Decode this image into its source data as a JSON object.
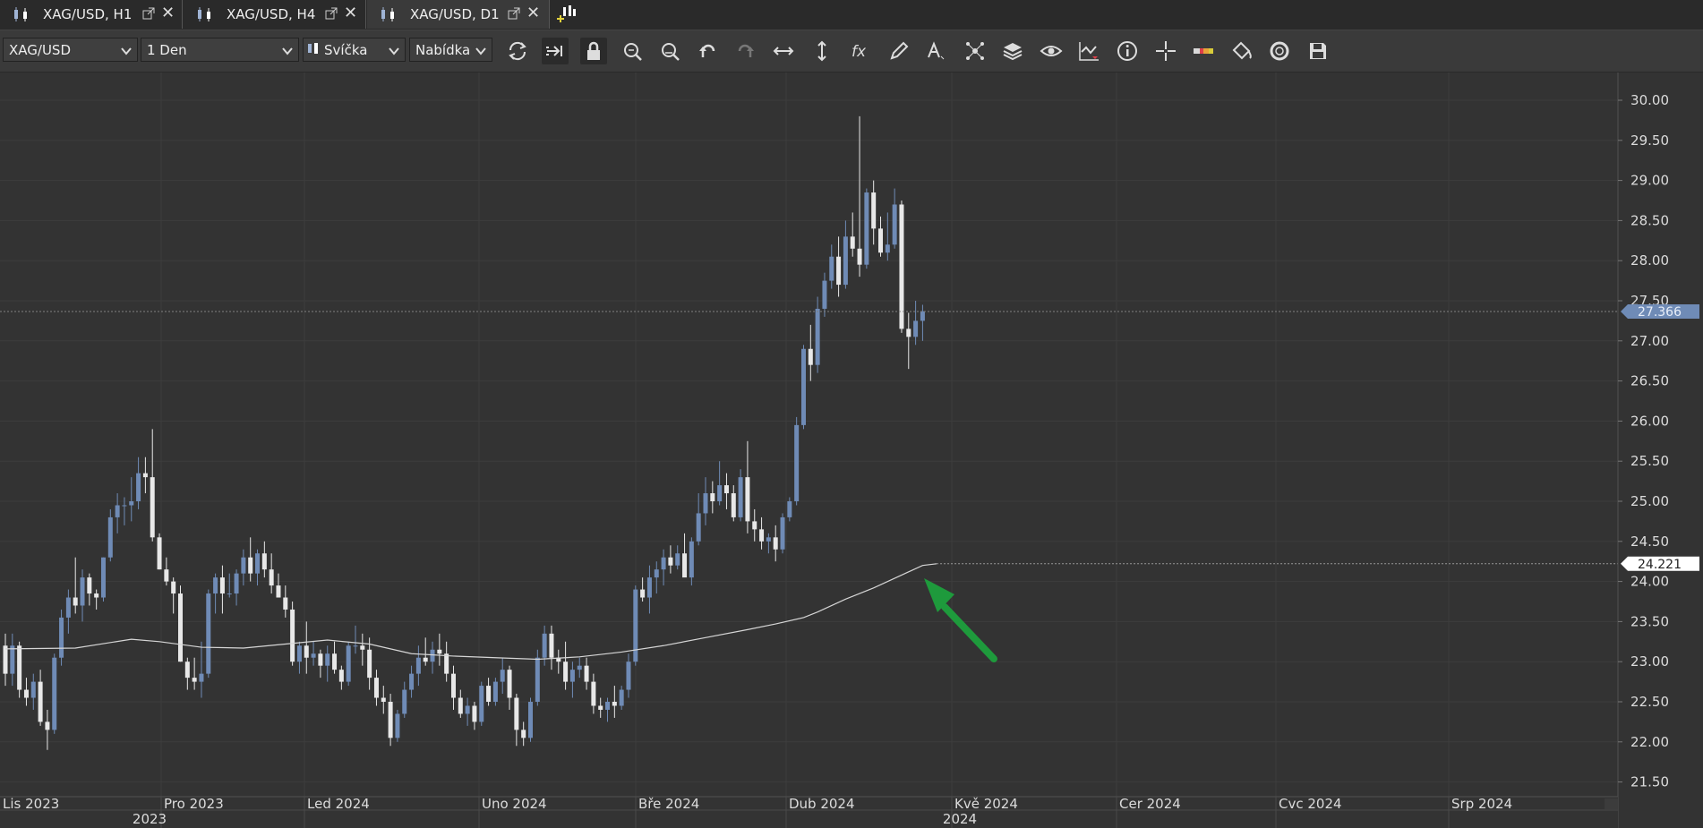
{
  "tabs": [
    {
      "label": "XAG/USD, H1",
      "active": false
    },
    {
      "label": "XAG/USD, H4",
      "active": false
    },
    {
      "label": "XAG/USD, D1",
      "active": true
    }
  ],
  "new_tab_icon": "add-chart-icon",
  "toolbar": {
    "instrument": "XAG/USD",
    "period": "1 Den",
    "chart_type": "Svíčka",
    "price_side": "Nabídka",
    "icons": [
      "refresh-icon",
      "auto-shift-icon",
      "lock-icon",
      "zoom-in-icon",
      "zoom-out-icon",
      "undo-icon",
      "redo-icon",
      "fit-horizontal-icon",
      "fit-vertical-icon",
      "function-icon",
      "pencil-icon",
      "text-icon",
      "network-icon",
      "layers-icon",
      "eye-icon",
      "signal-icon",
      "info-icon",
      "crosshair-icon",
      "level-indicator-icon",
      "paint-bucket-icon",
      "cycle-icon",
      "save-icon"
    ]
  },
  "colors": {
    "background": "#333333",
    "bull": "#6f8bb6",
    "bear": "#e8e8e8",
    "ma_line": "#d6d6d6",
    "arrow": "#1e9a3c",
    "grid": "#3d3d3d"
  },
  "chart_data": {
    "type": "candlestick",
    "title": "",
    "y_ticks": [
      "30.00",
      "29.50",
      "29.00",
      "28.50",
      "28.00",
      "27.50",
      "27.00",
      "26.50",
      "26.00",
      "25.50",
      "25.00",
      "24.50",
      "24.00",
      "23.50",
      "23.00",
      "22.50",
      "22.00",
      "21.50"
    ],
    "ylim": [
      21.4,
      30.3
    ],
    "x_month_labels": [
      "Lis 2023",
      "Pro 2023",
      "Led 2024",
      "Uno 2024",
      "Bře 2024",
      "Dub 2024",
      "Kvě 2024",
      "Cer 2024",
      "Cvc 2024",
      "Srp 2024"
    ],
    "x_year_labels": [
      "2023",
      "2024"
    ],
    "x_range_days": [
      0,
      230
    ],
    "current_price": "27.366",
    "ma_value": "24.221",
    "candles": [
      [
        0,
        23.2,
        23.35,
        22.7,
        22.85
      ],
      [
        1,
        22.85,
        23.35,
        22.7,
        23.2
      ],
      [
        2,
        23.2,
        23.25,
        22.55,
        22.65
      ],
      [
        3,
        22.65,
        22.8,
        22.45,
        22.55
      ],
      [
        4,
        22.55,
        22.85,
        22.4,
        22.75
      ],
      [
        5,
        22.75,
        22.9,
        22.2,
        22.25
      ],
      [
        6,
        22.25,
        22.4,
        21.9,
        22.15
      ],
      [
        7,
        22.15,
        23.1,
        22.1,
        23.05
      ],
      [
        8,
        23.05,
        23.65,
        22.95,
        23.55
      ],
      [
        9,
        23.55,
        23.9,
        23.35,
        23.8
      ],
      [
        10,
        23.8,
        24.3,
        23.6,
        23.7
      ],
      [
        11,
        23.7,
        24.15,
        23.5,
        24.05
      ],
      [
        12,
        24.05,
        24.1,
        23.7,
        23.85
      ],
      [
        13,
        23.85,
        23.9,
        23.65,
        23.8
      ],
      [
        14,
        23.8,
        24.3,
        23.75,
        24.3
      ],
      [
        15,
        24.3,
        24.9,
        24.25,
        24.8
      ],
      [
        16,
        24.8,
        25.1,
        24.6,
        24.95
      ],
      [
        17,
        24.95,
        25.05,
        24.7,
        24.95
      ],
      [
        18,
        24.95,
        25.3,
        24.75,
        25.0
      ],
      [
        19,
        25.0,
        25.55,
        24.9,
        25.35
      ],
      [
        20,
        25.35,
        25.55,
        25.1,
        25.3
      ],
      [
        21,
        25.3,
        25.9,
        24.5,
        24.55
      ],
      [
        22,
        24.55,
        24.6,
        24.15,
        24.15
      ],
      [
        23,
        24.15,
        24.3,
        23.95,
        24.0
      ],
      [
        24,
        24.0,
        24.05,
        23.6,
        23.85
      ],
      [
        25,
        23.85,
        23.95,
        23.0,
        23.0
      ],
      [
        26,
        23.0,
        23.05,
        22.65,
        22.8
      ],
      [
        27,
        22.8,
        23.05,
        22.65,
        22.75
      ],
      [
        28,
        22.75,
        23.25,
        22.55,
        22.85
      ],
      [
        29,
        22.85,
        23.9,
        22.8,
        23.85
      ],
      [
        30,
        23.85,
        24.1,
        23.6,
        24.05
      ],
      [
        31,
        24.05,
        24.2,
        23.6,
        23.85
      ],
      [
        32,
        23.85,
        24.1,
        23.8,
        23.85
      ],
      [
        33,
        23.85,
        24.15,
        23.7,
        24.1
      ],
      [
        34,
        24.1,
        24.4,
        23.95,
        24.3
      ],
      [
        35,
        24.3,
        24.55,
        24.0,
        24.1
      ],
      [
        36,
        24.1,
        24.4,
        23.95,
        24.35
      ],
      [
        37,
        24.35,
        24.5,
        24.05,
        24.15
      ],
      [
        38,
        24.15,
        24.35,
        23.85,
        23.95
      ],
      [
        39,
        23.95,
        24.1,
        23.8,
        23.8
      ],
      [
        40,
        23.8,
        23.95,
        23.55,
        23.65
      ],
      [
        41,
        23.65,
        23.75,
        22.95,
        23.0
      ],
      [
        42,
        23.0,
        23.25,
        22.85,
        23.2
      ],
      [
        43,
        23.2,
        23.5,
        22.85,
        23.05
      ],
      [
        44,
        23.05,
        23.25,
        22.95,
        23.1
      ],
      [
        45,
        23.1,
        23.15,
        22.8,
        22.95
      ],
      [
        46,
        22.95,
        23.2,
        22.75,
        23.1
      ],
      [
        47,
        23.1,
        23.25,
        22.85,
        22.9
      ],
      [
        48,
        22.9,
        22.95,
        22.65,
        22.75
      ],
      [
        49,
        22.75,
        23.25,
        22.7,
        23.2
      ],
      [
        50,
        23.2,
        23.45,
        23.1,
        23.2
      ],
      [
        51,
        23.2,
        23.35,
        22.95,
        23.15
      ],
      [
        52,
        23.15,
        23.3,
        22.65,
        22.8
      ],
      [
        53,
        22.8,
        22.9,
        22.45,
        22.55
      ],
      [
        54,
        22.55,
        22.7,
        22.35,
        22.5
      ],
      [
        55,
        22.5,
        22.6,
        21.95,
        22.05
      ],
      [
        56,
        22.05,
        22.4,
        22.0,
        22.35
      ],
      [
        57,
        22.35,
        22.75,
        22.3,
        22.65
      ],
      [
        58,
        22.65,
        22.95,
        22.55,
        22.85
      ],
      [
        59,
        22.85,
        23.2,
        22.7,
        23.05
      ],
      [
        60,
        23.05,
        23.3,
        22.95,
        23.0
      ],
      [
        61,
        23.0,
        23.25,
        22.85,
        23.15
      ],
      [
        62,
        23.15,
        23.35,
        22.95,
        23.1
      ],
      [
        63,
        23.1,
        23.25,
        22.75,
        22.85
      ],
      [
        64,
        22.85,
        22.95,
        22.4,
        22.55
      ],
      [
        65,
        22.55,
        22.65,
        22.3,
        22.35
      ],
      [
        66,
        22.35,
        22.55,
        22.2,
        22.45
      ],
      [
        67,
        22.45,
        22.5,
        22.15,
        22.25
      ],
      [
        68,
        22.25,
        22.75,
        22.2,
        22.7
      ],
      [
        69,
        22.7,
        22.8,
        22.45,
        22.5
      ],
      [
        70,
        22.5,
        22.8,
        22.45,
        22.75
      ],
      [
        71,
        22.75,
        23.05,
        22.6,
        22.9
      ],
      [
        72,
        22.9,
        22.95,
        22.4,
        22.55
      ],
      [
        73,
        22.55,
        22.6,
        21.95,
        22.15
      ],
      [
        74,
        22.15,
        22.25,
        21.95,
        22.05
      ],
      [
        75,
        22.05,
        22.55,
        22.0,
        22.5
      ],
      [
        76,
        22.5,
        23.15,
        22.45,
        23.05
      ],
      [
        77,
        23.05,
        23.45,
        22.95,
        23.35
      ],
      [
        78,
        23.35,
        23.45,
        22.9,
        23.05
      ],
      [
        79,
        23.05,
        23.15,
        22.85,
        23.0
      ],
      [
        80,
        23.0,
        23.25,
        22.65,
        22.75
      ],
      [
        81,
        22.75,
        23.0,
        22.55,
        22.9
      ],
      [
        82,
        22.9,
        23.05,
        22.8,
        22.95
      ],
      [
        83,
        22.95,
        23.05,
        22.65,
        22.75
      ],
      [
        84,
        22.75,
        22.85,
        22.35,
        22.45
      ],
      [
        85,
        22.45,
        22.55,
        22.3,
        22.4
      ],
      [
        86,
        22.4,
        22.55,
        22.25,
        22.5
      ],
      [
        87,
        22.5,
        22.7,
        22.3,
        22.45
      ],
      [
        88,
        22.45,
        22.7,
        22.4,
        22.65
      ],
      [
        89,
        22.65,
        23.1,
        22.55,
        23.0
      ],
      [
        90,
        23.0,
        23.95,
        22.95,
        23.9
      ],
      [
        91,
        23.9,
        24.05,
        23.75,
        23.8
      ],
      [
        92,
        23.8,
        24.2,
        23.6,
        24.05
      ],
      [
        93,
        24.05,
        24.25,
        23.85,
        24.15
      ],
      [
        94,
        24.15,
        24.4,
        23.95,
        24.3
      ],
      [
        95,
        24.3,
        24.45,
        24.1,
        24.2
      ],
      [
        96,
        24.2,
        24.45,
        24.15,
        24.35
      ],
      [
        97,
        24.35,
        24.6,
        24.15,
        24.05
      ],
      [
        98,
        24.05,
        24.55,
        23.95,
        24.5
      ],
      [
        99,
        24.5,
        25.1,
        24.45,
        24.85
      ],
      [
        100,
        24.85,
        25.3,
        24.7,
        25.1
      ],
      [
        101,
        25.1,
        25.25,
        24.85,
        25.0
      ],
      [
        102,
        25.0,
        25.5,
        24.95,
        25.2
      ],
      [
        103,
        25.2,
        25.35,
        24.9,
        25.1
      ],
      [
        104,
        25.1,
        25.2,
        24.75,
        24.8
      ],
      [
        105,
        24.8,
        25.4,
        24.75,
        25.3
      ],
      [
        106,
        25.3,
        25.75,
        24.6,
        24.75
      ],
      [
        107,
        24.75,
        24.9,
        24.5,
        24.65
      ],
      [
        108,
        24.65,
        24.8,
        24.4,
        24.5
      ],
      [
        109,
        24.5,
        24.6,
        24.35,
        24.55
      ],
      [
        110,
        24.55,
        24.7,
        24.25,
        24.4
      ],
      [
        111,
        24.4,
        24.85,
        24.35,
        24.8
      ],
      [
        112,
        24.8,
        25.05,
        24.75,
        25.0
      ],
      [
        113,
        25.0,
        26.05,
        24.95,
        25.95
      ],
      [
        114,
        25.95,
        26.95,
        25.9,
        26.9
      ],
      [
        115,
        26.9,
        27.2,
        26.5,
        26.7
      ],
      [
        116,
        26.7,
        27.55,
        26.6,
        27.4
      ],
      [
        117,
        27.4,
        27.85,
        27.3,
        27.75
      ],
      [
        118,
        27.75,
        28.2,
        27.65,
        28.05
      ],
      [
        119,
        28.05,
        28.3,
        27.55,
        27.7
      ],
      [
        120,
        27.7,
        28.5,
        27.65,
        28.3
      ],
      [
        121,
        28.3,
        28.6,
        28.05,
        28.15
      ],
      [
        122,
        28.15,
        29.8,
        27.8,
        27.95
      ],
      [
        123,
        27.95,
        28.9,
        27.9,
        28.85
      ],
      [
        124,
        28.85,
        29.0,
        28.2,
        28.4
      ],
      [
        125,
        28.4,
        28.55,
        28.05,
        28.1
      ],
      [
        126,
        28.1,
        28.6,
        28.0,
        28.2
      ],
      [
        127,
        28.2,
        28.9,
        28.15,
        28.7
      ],
      [
        128,
        28.7,
        28.75,
        27.1,
        27.15
      ],
      [
        129,
        27.15,
        27.35,
        26.65,
        27.05
      ],
      [
        130,
        27.05,
        27.5,
        26.95,
        27.25
      ],
      [
        131,
        27.25,
        27.45,
        27.0,
        27.37
      ]
    ],
    "ma": [
      [
        0,
        23.16
      ],
      [
        10,
        23.17
      ],
      [
        18,
        23.28
      ],
      [
        22,
        23.25
      ],
      [
        28,
        23.18
      ],
      [
        34,
        23.17
      ],
      [
        40,
        23.22
      ],
      [
        46,
        23.27
      ],
      [
        52,
        23.22
      ],
      [
        58,
        23.1
      ],
      [
        64,
        23.07
      ],
      [
        70,
        23.05
      ],
      [
        76,
        23.03
      ],
      [
        82,
        23.06
      ],
      [
        88,
        23.12
      ],
      [
        94,
        23.2
      ],
      [
        100,
        23.3
      ],
      [
        106,
        23.4
      ],
      [
        110,
        23.47
      ],
      [
        114,
        23.55
      ],
      [
        116,
        23.62
      ],
      [
        120,
        23.78
      ],
      [
        124,
        23.92
      ],
      [
        128,
        24.08
      ],
      [
        131,
        24.2
      ],
      [
        133,
        24.221
      ]
    ]
  }
}
